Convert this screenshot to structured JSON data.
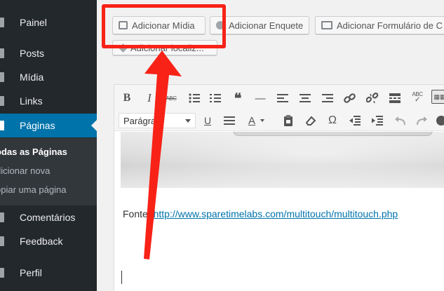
{
  "sidebar": {
    "items": [
      {
        "label": "Painel",
        "icon": "dashboard-icon"
      },
      {
        "label": "Posts",
        "icon": "pin-icon"
      },
      {
        "label": "Mídia",
        "icon": "media-icon"
      },
      {
        "label": "Links",
        "icon": "links-icon"
      },
      {
        "label": "Páginas",
        "icon": "pages-icon"
      },
      {
        "label": "Comentários",
        "icon": "comments-icon"
      },
      {
        "label": "Feedback",
        "icon": "feedback-icon"
      },
      {
        "label": "Perfil",
        "icon": "profile-icon"
      }
    ],
    "submenu": [
      {
        "label": "odas as Páginas"
      },
      {
        "label": "dicionar nova"
      },
      {
        "label": "opiar uma página"
      }
    ]
  },
  "media_buttons": {
    "add_media": "Adicionar Mídia",
    "add_poll": "Adicionar Enquete",
    "add_form": "Adicionar Formulário de C",
    "add_location": "Adicionar localiz..."
  },
  "editor": {
    "format_select": "Parágrafo",
    "toolbar_text": {
      "bold": "B",
      "italic": "I",
      "strikethrough": "ABC",
      "quote": "❝",
      "hr": "—",
      "underline": "U",
      "color": "A",
      "omega": "Ω",
      "spellcheck": "ABC"
    },
    "content": {
      "source_label": "Fonte:",
      "source_url": "http://www.sparetimelabs.com/multitouch/multitouch.php"
    }
  },
  "colors": {
    "sidebar_bg": "#23282d",
    "active_menu": "#0073aa",
    "annotation": "#f82217",
    "link": "#0073aa"
  }
}
